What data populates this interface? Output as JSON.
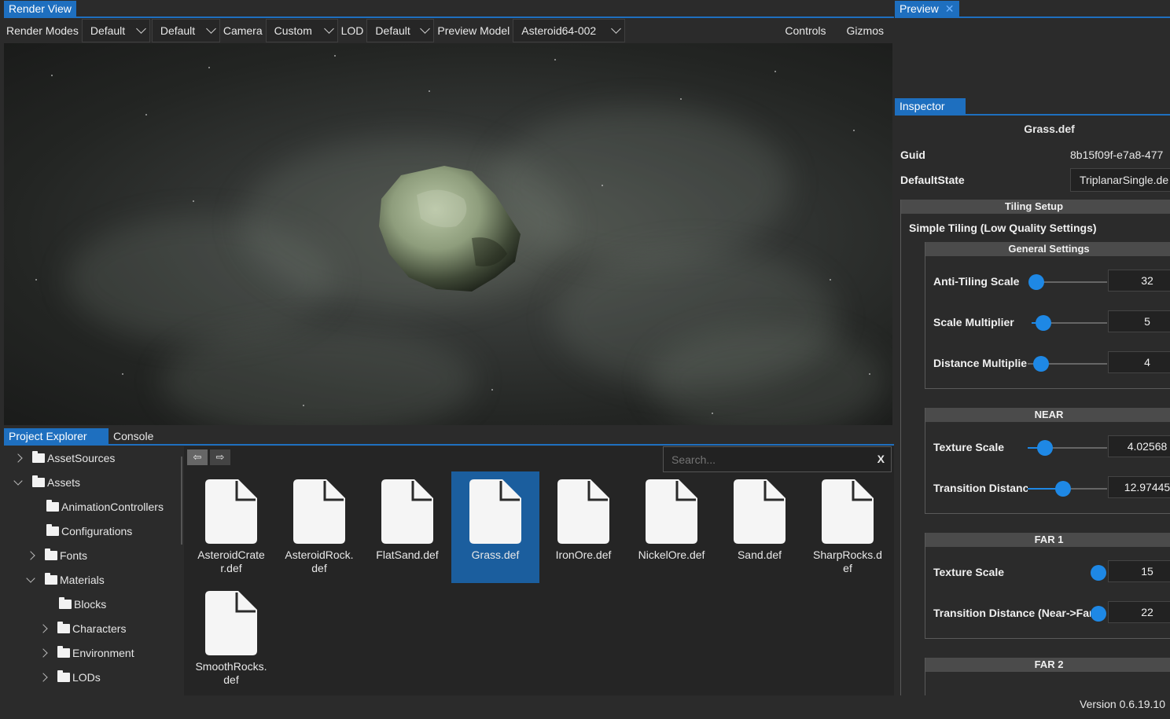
{
  "render_view": {
    "tab_label": "Render View",
    "toolbar": {
      "render_modes_label": "Render Modes",
      "render_mode_1": "Default",
      "render_mode_2": "Default",
      "camera_label": "Camera",
      "camera_value": "Custom",
      "lod_label": "LOD",
      "lod_value": "Default",
      "preview_model_label": "Preview Model",
      "preview_model_value": "Asteroid64-002",
      "controls_label": "Controls",
      "gizmos_label": "Gizmos"
    }
  },
  "preview": {
    "tab_label": "Preview",
    "close_glyph": "✕"
  },
  "bottom_panel": {
    "tabs": [
      "Project Explorer",
      "Console"
    ],
    "search_placeholder": "Search...",
    "search_clear": "X",
    "back_glyph": "⇦",
    "forward_glyph": "⇨",
    "tree": [
      {
        "label": "AssetSources",
        "expander": "collapsed",
        "depth": 0
      },
      {
        "label": "Assets",
        "expander": "expanded",
        "depth": 0
      },
      {
        "label": "AnimationControllers",
        "expander": "none",
        "depth": 1
      },
      {
        "label": "Configurations",
        "expander": "none",
        "depth": 1
      },
      {
        "label": "Fonts",
        "expander": "collapsed",
        "depth": 1
      },
      {
        "label": "Materials",
        "expander": "expanded",
        "depth": 1
      },
      {
        "label": "Blocks",
        "expander": "none",
        "depth": 2
      },
      {
        "label": "Characters",
        "expander": "collapsed",
        "depth": 2
      },
      {
        "label": "Environment",
        "expander": "collapsed",
        "depth": 2
      },
      {
        "label": "LODs",
        "expander": "collapsed",
        "depth": 2
      }
    ],
    "files": [
      {
        "name": "AsteroidCrater.def",
        "display": "AsteroidCrate\nr.def",
        "selected": false
      },
      {
        "name": "AsteroidRock.def",
        "display": "AsteroidRock.\ndef",
        "selected": false
      },
      {
        "name": "FlatSand.def",
        "display": "FlatSand.def",
        "selected": false
      },
      {
        "name": "Grass.def",
        "display": "Grass.def",
        "selected": true
      },
      {
        "name": "IronOre.def",
        "display": "IronOre.def",
        "selected": false
      },
      {
        "name": "NickelOre.def",
        "display": "NickelOre.def",
        "selected": false
      },
      {
        "name": "Sand.def",
        "display": "Sand.def",
        "selected": false
      },
      {
        "name": "SharpRocks.def",
        "display": "SharpRocks.d\nef",
        "selected": false
      },
      {
        "name": "SmoothRocks.def",
        "display": "SmoothRocks.\ndef",
        "selected": false
      }
    ]
  },
  "inspector": {
    "tab_label": "Inspector",
    "asset_title": "Grass.def",
    "guid_label": "Guid",
    "guid_value": "8b15f09f-e7a8-477",
    "default_state_label": "DefaultState",
    "default_state_value": "TriplanarSingle.de",
    "tiling_setup_title": "Tiling Setup",
    "simple_tiling_label": "Simple Tiling (Low Quality Settings)",
    "general_settings": {
      "title": "General Settings",
      "props": [
        {
          "label": "Anti-Tiling Scale",
          "value": "32",
          "level": 0.08
        },
        {
          "label": "Scale Multiplier",
          "value": "5",
          "level": 0.2
        },
        {
          "label": "Distance Multiplie",
          "value": "4",
          "level": 0.15
        }
      ]
    },
    "near": {
      "title": "NEAR",
      "props": [
        {
          "label": "Texture Scale",
          "value": "4.02568",
          "level": 0.22
        },
        {
          "label": "Transition Distanc",
          "value": "12.97445",
          "level": 0.44
        }
      ]
    },
    "far1": {
      "title": "FAR 1",
      "props": [
        {
          "label": "Texture Scale",
          "value": "15",
          "level": 0.0
        },
        {
          "label": "Transition Distance (Near->Far",
          "value": "22",
          "level": 0.0
        }
      ]
    },
    "far2": {
      "title": "FAR 2"
    }
  },
  "footer": {
    "version": "Version 0.6.19.10"
  },
  "colors": {
    "accent": "#1e6fbf",
    "selected_tile": "#1b5e9e",
    "slider": "#1e88e5"
  }
}
